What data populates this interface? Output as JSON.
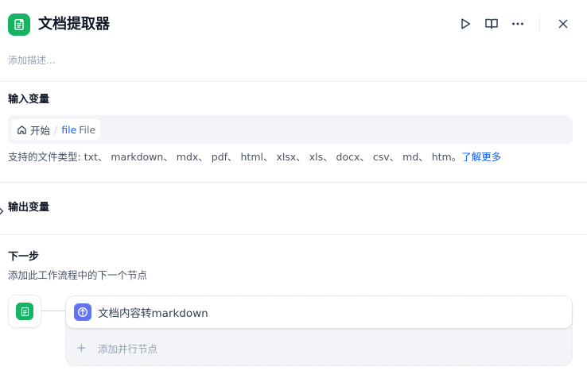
{
  "header": {
    "title": "文档提取器",
    "description_placeholder": "添加描述..."
  },
  "input_section": {
    "title": "输入变量",
    "variable": {
      "source": "开始",
      "separator": "/",
      "name": "file",
      "type": "File"
    },
    "supported_types_text": "支持的文件类型: txt、 markdown、 mdx、 pdf、 html、 xlsx、 xls、 docx、 csv、 md、 htm。",
    "learn_more": "了解更多"
  },
  "output_section": {
    "title": "输出变量"
  },
  "next_step": {
    "title": "下一步",
    "description": "添加此工作流程中的下一个节点",
    "next_node_label": "文档内容转markdown",
    "add_parallel_label": "添加并行节点"
  },
  "colors": {
    "accent_green": "#16b364",
    "link_blue": "#155eef",
    "node_indigo": "#6172f3"
  },
  "icons": {
    "app": "document-extractor-icon",
    "run": "play-icon",
    "docs": "book-open-icon",
    "more": "more-horizontal-icon",
    "close": "close-icon",
    "home": "home-icon",
    "expand": "chevron-right-icon",
    "next_node": "code-node-icon",
    "add": "plus-icon"
  }
}
